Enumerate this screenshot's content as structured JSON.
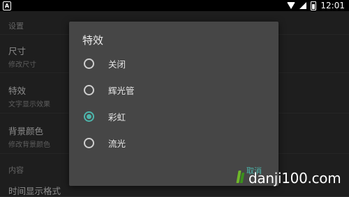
{
  "status_bar": {
    "left_badge": "A",
    "time": "12:01"
  },
  "settings": {
    "header_settings": "设置",
    "items": [
      {
        "title": "尺寸",
        "subtitle": "修改尺寸"
      },
      {
        "title": "特效",
        "subtitle": "文字显示效果"
      },
      {
        "title": "背景颜色",
        "subtitle": "修改背景颜色"
      }
    ],
    "header_content": "内容",
    "item_time_format": "时间显示格式"
  },
  "dialog": {
    "title": "特效",
    "options": [
      {
        "label": "关闭",
        "selected": false
      },
      {
        "label": "辉光管",
        "selected": false
      },
      {
        "label": "彩虹",
        "selected": true
      },
      {
        "label": "流光",
        "selected": false
      }
    ],
    "cancel_label": "取消"
  },
  "watermark": {
    "text": "danji100.com"
  },
  "colors": {
    "accent": "#4db6ac",
    "dialog_bg": "#464646",
    "screen_bg": "#2e2e2e"
  }
}
